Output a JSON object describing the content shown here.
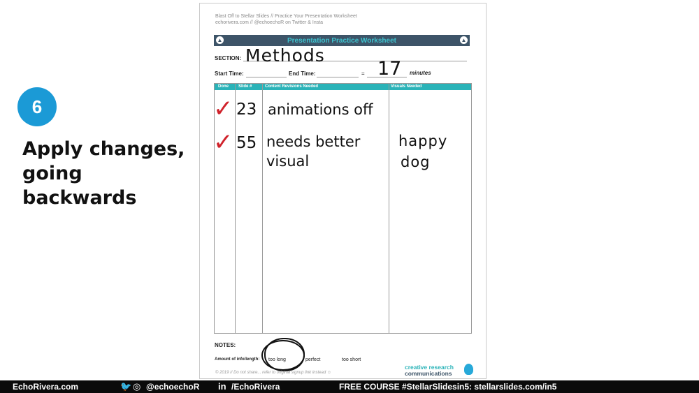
{
  "step": {
    "number": "6",
    "title_line1": "Apply changes,",
    "title_line2": "going backwards"
  },
  "worksheet": {
    "header_line1": "Blast Off to Stellar Slides // Practice Your Presentation Worksheet",
    "header_line2": "echorivera.com // @echoechoR on Twitter & Insta",
    "title": "Presentation Practice Worksheet",
    "section_label": "SECTION:",
    "section_value": "Methods",
    "start_time_label": "Start Time:",
    "end_time_label": "End Time:",
    "equals": "=",
    "duration_value": "17",
    "minutes_label": "minutes",
    "columns": [
      "Done",
      "Slide #",
      "Content Revisions Needed",
      "Visuals Needed"
    ],
    "rows": [
      {
        "done": "✓",
        "slide": "23",
        "revision_line1": "animations off",
        "revision_line2": "",
        "visual_line1": "",
        "visual_line2": ""
      },
      {
        "done": "✓",
        "slide": "55",
        "revision_line1": "needs better",
        "revision_line2": "visual",
        "visual_line1": "happy",
        "visual_line2": "dog"
      }
    ],
    "notes_label": "NOTES:",
    "amount_label": "Amount of info/length:",
    "options": [
      "too long",
      "perfect",
      "too short"
    ],
    "copyright": "© 2019 // Do not share... refer to original signup link instead ☺",
    "brand_line1": "creative research",
    "brand_line2": "communications"
  },
  "footer": {
    "site": "EchoRivera.com",
    "social_handle": "@echoechoR",
    "linkedin": "/EchoRivera",
    "course": "FREE COURSE #StellarSlidesin5: stellarslides.com/in5"
  },
  "colors": {
    "step_badge": "#1b9ad6",
    "title_bar": "#3d5468",
    "title_text": "#3fc3cf",
    "table_header": "#2ab3b8",
    "check": "#d0222b"
  }
}
